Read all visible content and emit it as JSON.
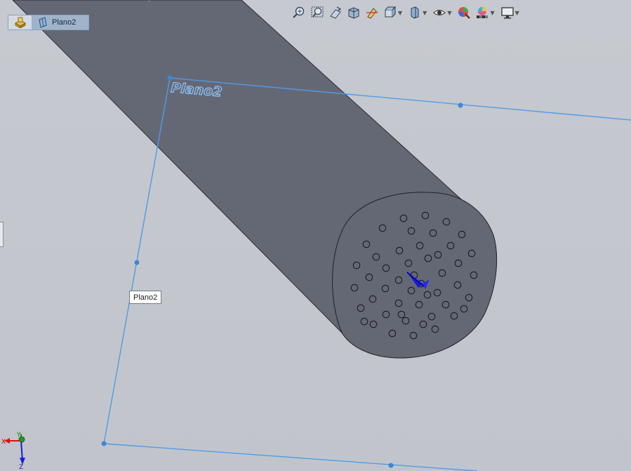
{
  "breadcrumb": {
    "part_icon": "part-icon",
    "plane_icon": "plane-icon",
    "plane_label": "Plano2"
  },
  "toolbar": {
    "buttons": [
      {
        "icon": "zoom-to-fit-icon"
      },
      {
        "icon": "zoom-to-area-icon"
      },
      {
        "icon": "previous-view-icon"
      },
      {
        "icon": "section-view-icon"
      },
      {
        "icon": "dynamic-annotation-icon"
      },
      {
        "icon": "view-orientation-icon",
        "dropdown": true
      },
      {
        "icon": "display-style-icon",
        "dropdown": true
      },
      {
        "icon": "hide-show-items-icon",
        "dropdown": true
      },
      {
        "icon": "edit-appearance-icon"
      },
      {
        "icon": "apply-scene-icon",
        "dropdown": true
      },
      {
        "icon": "view-settings-icon",
        "dropdown": true
      }
    ]
  },
  "model": {
    "plane_name_3d": "Plano2",
    "plane_tag": "Plano2",
    "hole_count": 49
  },
  "triad": {
    "x_label": "X",
    "y_label": "Y",
    "z_label": "Z"
  },
  "colors": {
    "background": "#c4c8ce",
    "cylinder": "#646875",
    "plane_edge": "#4f9be8",
    "plane_text": "#8ec0f2"
  }
}
